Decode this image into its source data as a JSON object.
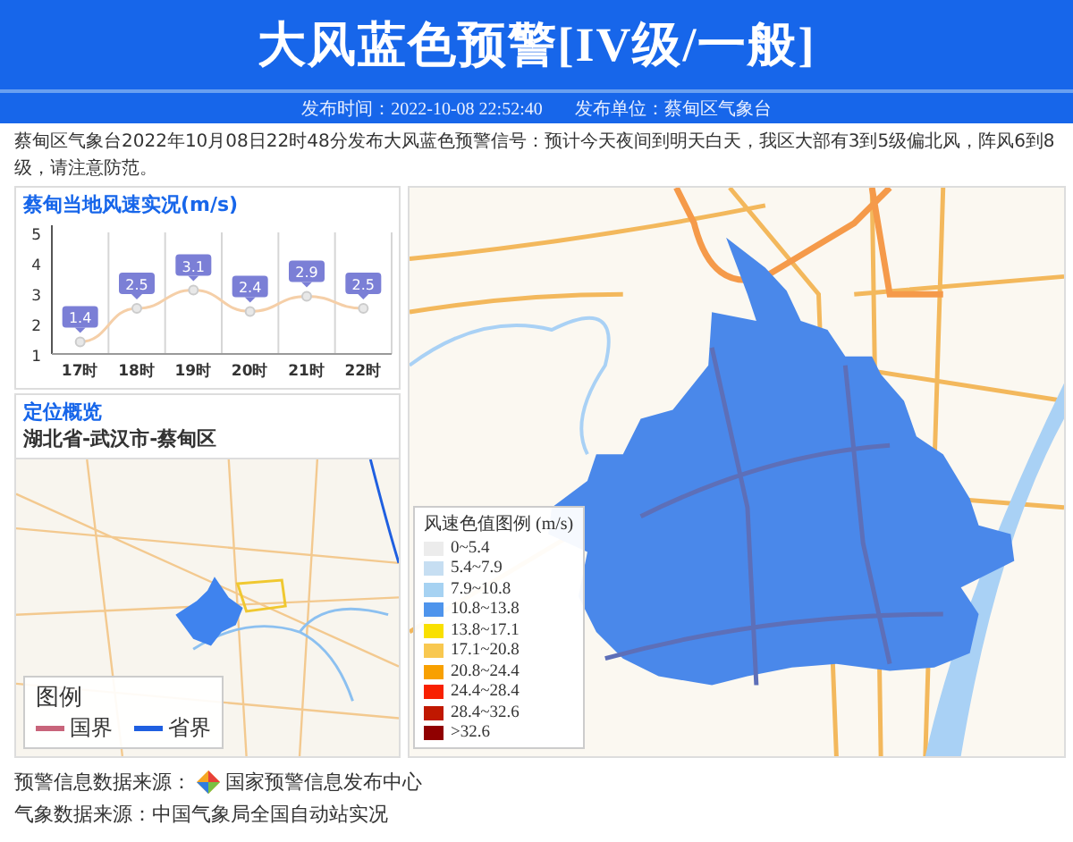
{
  "header": {
    "title": "大风蓝色预警[IV级/一般]",
    "publish_time": "发布时间：2022-10-08 22:52:40",
    "publisher": "发布单位：蔡甸区气象台"
  },
  "description": "蔡甸区气象台2022年10月08日22时48分发布大风蓝色预警信号：预计今天夜间到明天白天，我区大部有3到5级偏北风，阵风6到8级，请注意防范。",
  "wind_panel": {
    "title": "蔡甸当地风速实况(m/s)",
    "chart_data": {
      "type": "line",
      "categories": [
        "17时",
        "18时",
        "19时",
        "20时",
        "21时",
        "22时"
      ],
      "series": [
        {
          "color": "#f5cfa8",
          "marker": "circle",
          "values": [
            1.4,
            2.5,
            3.1,
            2.4,
            2.9,
            2.5
          ]
        }
      ],
      "ylim": [
        1,
        5
      ],
      "yticks": [
        1,
        2,
        3,
        4,
        5
      ],
      "data_labels": true
    }
  },
  "location_panel": {
    "title": "定位概览",
    "region": "湖北省-武汉市-蔡甸区",
    "legend": {
      "title": "图例",
      "items": [
        {
          "label": "国界",
          "color": "#c8647a"
        },
        {
          "label": "省界",
          "color": "#1f5fe0"
        }
      ]
    }
  },
  "map_legend": {
    "title": "风速色值图例",
    "unit": "(m/s)",
    "items": [
      {
        "label": "0~5.4",
        "color": "#ececec"
      },
      {
        "label": "5.4~7.9",
        "color": "#c6def2"
      },
      {
        "label": "7.9~10.8",
        "color": "#a6d2f2"
      },
      {
        "label": "10.8~13.8",
        "color": "#4e94ec"
      },
      {
        "label": "13.8~17.1",
        "color": "#f9e000"
      },
      {
        "label": "17.1~20.8",
        "color": "#f8c850"
      },
      {
        "label": "20.8~24.4",
        "color": "#f8a000"
      },
      {
        "label": "24.4~28.4",
        "color": "#f82000"
      },
      {
        "label": "28.4~32.6",
        "color": "#c01800"
      },
      {
        "label": ">32.6",
        "color": "#900000"
      }
    ]
  },
  "footer": {
    "warning_source_label": "预警信息数据来源：",
    "warning_source": "国家预警信息发布中心",
    "weather_source": "气象数据来源：中国气象局全国自动站实况"
  }
}
